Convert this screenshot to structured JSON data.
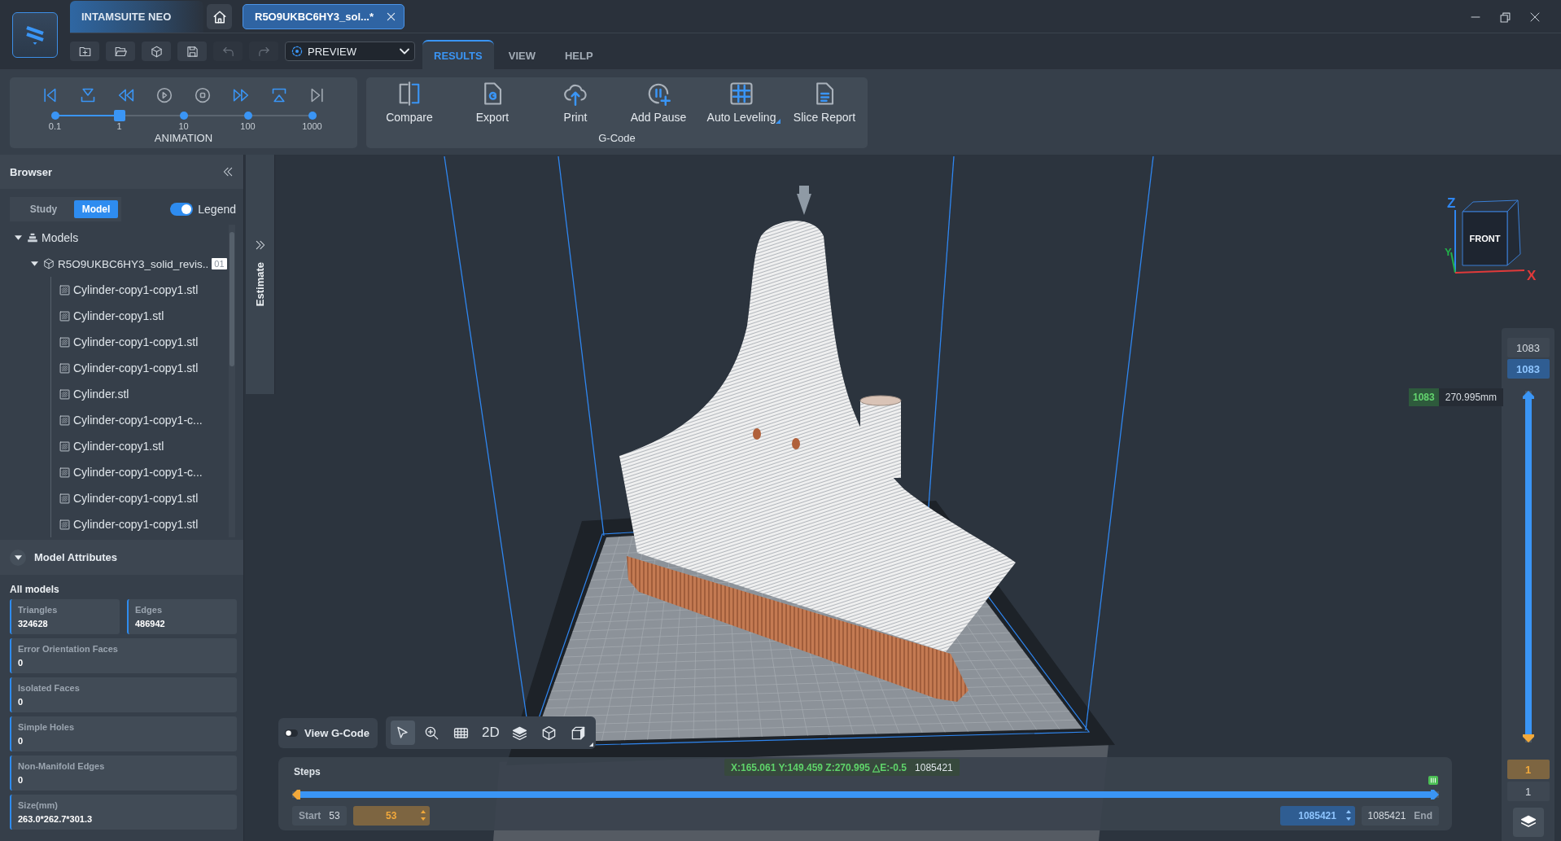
{
  "title_bar": {
    "app_name": "INTAMSUITE NEO",
    "tabs": [
      {
        "label": "R5O9UKBC6HY3_sol...*",
        "selected": true
      }
    ]
  },
  "quick_actions": [
    {
      "kind": "new",
      "disabled": false
    },
    {
      "kind": "open",
      "disabled": false
    },
    {
      "kind": "import",
      "disabled": false
    },
    {
      "kind": "save",
      "disabled": false
    },
    {
      "kind": "undo",
      "disabled": true
    },
    {
      "kind": "redo",
      "disabled": true
    }
  ],
  "mode_select": {
    "value": "PREVIEW"
  },
  "ribbon_tabs": [
    {
      "label": "RESULTS",
      "selected": true
    },
    {
      "label": "VIEW",
      "selected": false
    },
    {
      "label": "HELP",
      "selected": false
    }
  ],
  "animation": {
    "label": "ANIMATION",
    "controls": [
      {
        "kind": "first",
        "disabled": false
      },
      {
        "kind": "step-down",
        "disabled": false
      },
      {
        "kind": "rewind",
        "disabled": false
      },
      {
        "kind": "play",
        "disabled": true
      },
      {
        "kind": "stop",
        "disabled": true
      },
      {
        "kind": "forward",
        "disabled": false
      },
      {
        "kind": "step-up",
        "disabled": false
      },
      {
        "kind": "last",
        "disabled": true
      }
    ],
    "speed": {
      "ticks": [
        "0.1",
        "1",
        "10",
        "100",
        "1000"
      ],
      "level": 0.25
    }
  },
  "gcode": {
    "label": "G-Code",
    "buttons": [
      {
        "kind": "compare",
        "label": "Compare",
        "expandable": false
      },
      {
        "kind": "export",
        "label": "Export",
        "expandable": false
      },
      {
        "kind": "print",
        "label": "Print",
        "expandable": false
      },
      {
        "kind": "pause",
        "label": "Add Pause",
        "expandable": false
      },
      {
        "kind": "leveling",
        "label": "Auto Leveling",
        "expandable": true
      },
      {
        "kind": "report",
        "label": "Slice Report",
        "expandable": false
      }
    ]
  },
  "browser": {
    "title": "Browser",
    "view_tabs": [
      {
        "label": "Study",
        "selected": false
      },
      {
        "label": "Model",
        "selected": true
      }
    ],
    "legend": {
      "label": "Legend",
      "on": true
    },
    "tree": [
      {
        "kind": "folder",
        "label": "Models",
        "expanded": true,
        "children": [
          {
            "kind": "assembly",
            "label": "R5O9UKBC6HY3_solid_revis..",
            "badge": "01",
            "expanded": true,
            "children": [
              {
                "kind": "mesh",
                "label": "Cylinder-copy1-copy1.stl"
              },
              {
                "kind": "mesh",
                "label": "Cylinder-copy1.stl"
              },
              {
                "kind": "mesh",
                "label": "Cylinder-copy1-copy1.stl"
              },
              {
                "kind": "mesh",
                "label": "Cylinder-copy1-copy1.stl"
              },
              {
                "kind": "mesh",
                "label": "Cylinder.stl"
              },
              {
                "kind": "mesh",
                "label": "Cylinder-copy1-copy1-c..."
              },
              {
                "kind": "mesh",
                "label": "Cylinder-copy1.stl"
              },
              {
                "kind": "mesh",
                "label": "Cylinder-copy1-copy1-c..."
              },
              {
                "kind": "mesh",
                "label": "Cylinder-copy1-copy1.stl"
              },
              {
                "kind": "mesh",
                "label": "Cylinder-copy1-copy1.stl"
              }
            ]
          }
        ]
      }
    ]
  },
  "estimate": {
    "label": "Estimate"
  },
  "model_attributes": {
    "title": "Model Attributes",
    "expanded": true,
    "scope": "All models",
    "fields": [
      {
        "kind": "half",
        "label": "Triangles",
        "value": "324628"
      },
      {
        "kind": "half",
        "label": "Edges",
        "value": "486942"
      },
      {
        "kind": "full",
        "label": "Error Orientation Faces",
        "value": "0"
      },
      {
        "kind": "full",
        "label": "Isolated Faces",
        "value": "0"
      },
      {
        "kind": "full",
        "label": "Simple Holes",
        "value": "0"
      },
      {
        "kind": "full",
        "label": "Non-Manifold Edges",
        "value": "0"
      },
      {
        "kind": "full",
        "label": "Size(mm)",
        "value": "263.0*262.7*301.3"
      }
    ]
  },
  "viewport": {
    "view_cube": {
      "front": "FRONT",
      "axes": {
        "x": "X",
        "y": "Y",
        "z": "Z"
      }
    },
    "gcode_toggle": {
      "label": "View G-Code",
      "on": false
    },
    "tools": [
      {
        "kind": "select",
        "selected": true
      },
      {
        "kind": "zoom",
        "selected": false
      },
      {
        "kind": "grid",
        "selected": false
      },
      {
        "kind": "text",
        "label": "2D",
        "selected": false
      },
      {
        "kind": "layers",
        "selected": false
      },
      {
        "kind": "box",
        "selected": false
      },
      {
        "kind": "solid",
        "selected": false
      }
    ]
  },
  "layers": {
    "max": "1083",
    "upper": {
      "value": "1083",
      "level": 1
    },
    "lower": {
      "value": "1",
      "level": 0
    },
    "min": "1",
    "tooltip": {
      "layer": "1083",
      "height": "270.995mm"
    }
  },
  "steps": {
    "title": "Steps",
    "readout": {
      "position": "X:165.061 Y:149.459 Z:270.995 △E:-0.5",
      "step": "1085421"
    },
    "start": {
      "label": "Start",
      "value": "53"
    },
    "lower": {
      "value": "53",
      "level": 0
    },
    "upper": {
      "value": "1085421",
      "level": 1
    },
    "end": {
      "value": "1085421",
      "label": "End"
    }
  }
}
